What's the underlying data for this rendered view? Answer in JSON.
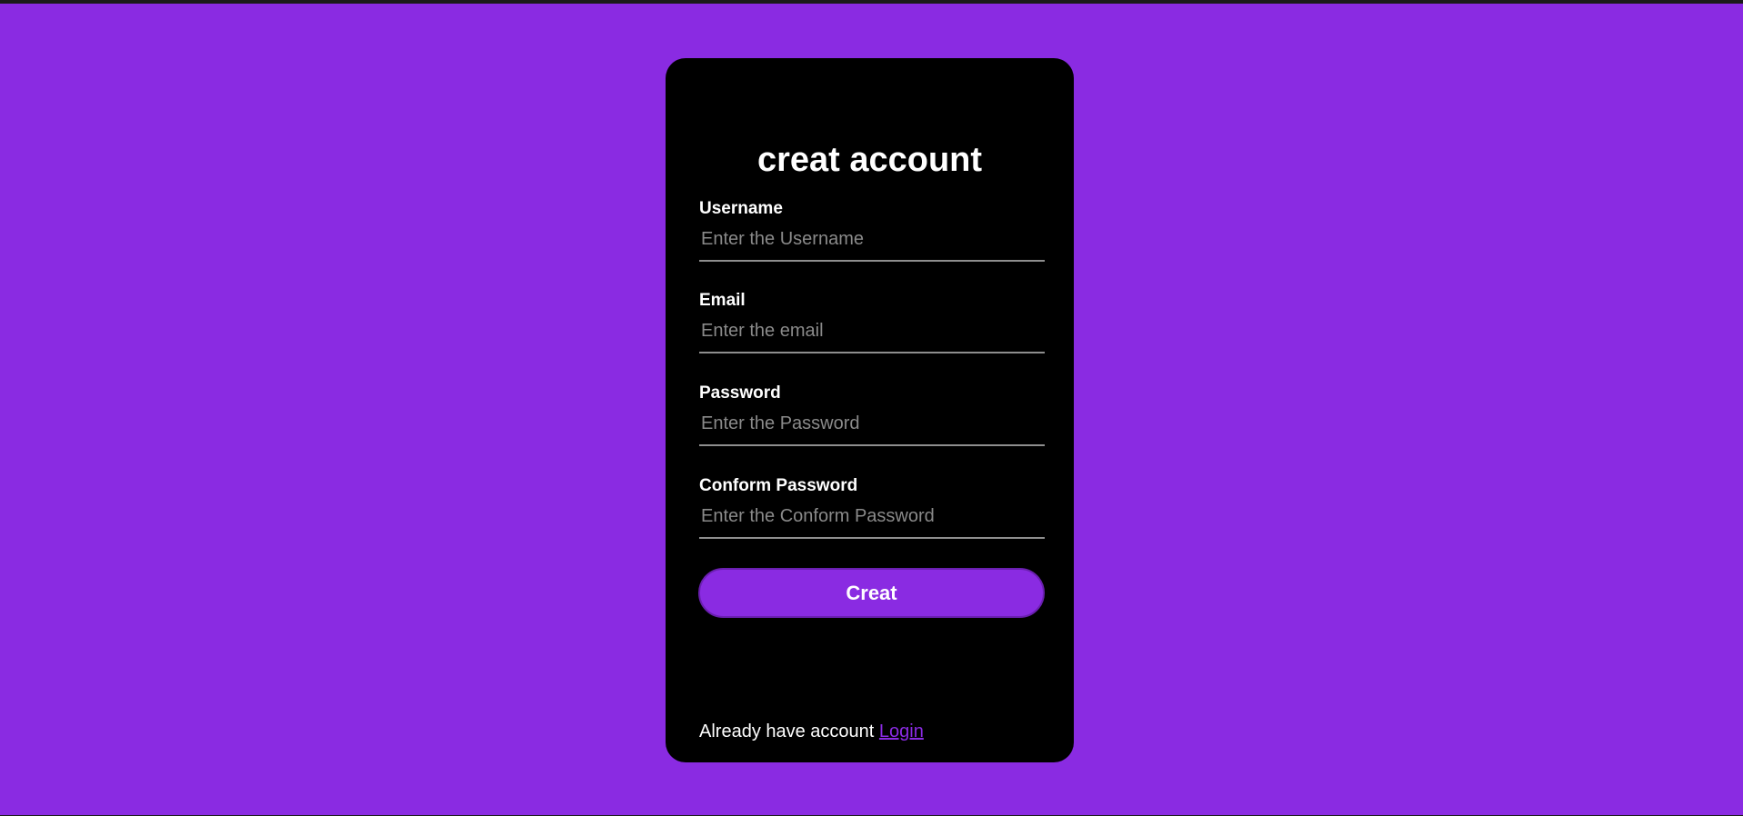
{
  "colors": {
    "background": "#8a2be2",
    "card": "#000000",
    "accent": "#8a2be2",
    "text": "#ffffff",
    "placeholder": "#8a8a8a",
    "underline": "#8e8e8e"
  },
  "form": {
    "title": "creat account",
    "fields": [
      {
        "label": "Username",
        "placeholder": "Enter the Username",
        "value": ""
      },
      {
        "label": "Email",
        "placeholder": "Enter the email",
        "value": ""
      },
      {
        "label": "Password",
        "placeholder": "Enter the Password",
        "value": ""
      },
      {
        "label": "Conform Password",
        "placeholder": "Enter the Conform Password",
        "value": ""
      }
    ],
    "submit_label": "Creat"
  },
  "footer": {
    "text": "Already have account",
    "link_label": "Login"
  }
}
